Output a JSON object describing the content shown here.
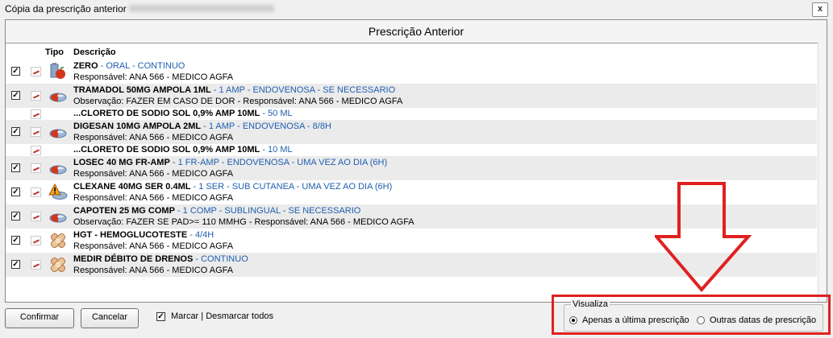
{
  "window": {
    "title": "Cópia da prescrição anterior",
    "close_label": "x"
  },
  "panel": {
    "title": "Prescrição Anterior"
  },
  "columns": {
    "tipo": "Tipo",
    "descricao": "Descrição"
  },
  "rows": [
    {
      "kind": "main",
      "icon": "bottle-icon",
      "checked": "✓",
      "name": "ZERO",
      "details": " - ORAL - CONTINUO",
      "line2": "Responsável: ANA 566 - MEDICO AGFA"
    },
    {
      "kind": "main",
      "icon": "pill-icon",
      "checked": "✓",
      "name": "TRAMADOL 50MG AMPOLA 1ML",
      "details": " - 1 AMP - ENDOVENOSA - SE NECESSARIO",
      "line2": "Observação: FAZER EM CASO DE DOR - Responsável: ANA 566 - MEDICO AGFA"
    },
    {
      "kind": "sub",
      "name": "...CLORETO DE SODIO SOL 0,9% AMP 10ML",
      "details": " - 50 ML"
    },
    {
      "kind": "main",
      "icon": "pill-icon",
      "checked": "✓",
      "name": "DIGESAN 10MG AMPOLA 2ML",
      "details": " - 1 AMP - ENDOVENOSA - 8/8H",
      "line2": "Responsável: ANA 566 - MEDICO AGFA"
    },
    {
      "kind": "sub",
      "name": "...CLORETO DE SODIO SOL 0,9% AMP 10ML",
      "details": " - 10 ML"
    },
    {
      "kind": "main",
      "icon": "pill-icon",
      "checked": "✓",
      "name": "LOSEC  40 MG FR-AMP",
      "details": " - 1 FR-AMP - ENDOVENOSA - UMA VEZ AO DIA (6H)",
      "line2": "Responsável: ANA 566 - MEDICO AGFA"
    },
    {
      "kind": "main",
      "icon": "warning-pill-icon",
      "checked": "✓",
      "name": "CLEXANE 40MG SER 0.4ML",
      "details": " - 1 SER - SUB CUTANEA - UMA VEZ AO DIA (6H)",
      "line2": "Responsável: ANA 566 - MEDICO AGFA"
    },
    {
      "kind": "main",
      "icon": "pill-icon",
      "checked": "✓",
      "name": "CAPOTEN 25 MG COMP",
      "details": " - 1 COMP - SUBLINGUAL - SE NECESSARIO",
      "line2": "Observação: FAZER SE PAD>= 110 MMHG - Responsável: ANA 566 - MEDICO AGFA"
    },
    {
      "kind": "main",
      "icon": "bandage-icon",
      "checked": "✓",
      "name": "HGT - HEMOGLUCOTESTE",
      "details": " - 4/4H",
      "line2": "Responsável: ANA 566 - MEDICO AGFA"
    },
    {
      "kind": "main",
      "icon": "bandage-icon",
      "checked": "✓",
      "name": "MEDIR DÉBITO DE DRENOS",
      "details": " - CONTINUO",
      "line2": "Responsável: ANA 566 - MEDICO AGFA"
    }
  ],
  "footer": {
    "confirm": "Confirmar",
    "cancel": "Cancelar",
    "toggle_all": "Marcar | Desmarcar todos",
    "toggle_checked": "✓",
    "visualiza": {
      "legend": "Visualiza",
      "option_last": "Apenas a última prescrição",
      "option_other": "Outras datas de prescrição",
      "selected": "option_last"
    }
  },
  "colors": {
    "accent_blue": "#1f5fb0",
    "highlight_red": "#e02020"
  }
}
